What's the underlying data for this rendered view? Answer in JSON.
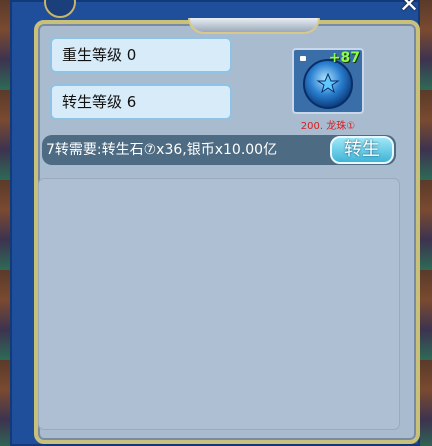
{
  "header": {
    "close_icon": "close-icon"
  },
  "status": {
    "reborn_level": "重生等级  0",
    "rebirth_level": "转生等级  6"
  },
  "item": {
    "icon": "dragon-ball-icon",
    "count": "+87",
    "caption": "200. 龙珠①"
  },
  "requirement": {
    "text": "7转需要:转生石⑦x36,银币x10.00亿",
    "button_label": "转生"
  },
  "colors": {
    "frame": "#1f4f9a",
    "panel": "#a9bbcf",
    "gold": "#c9c07a",
    "count_green": "#8dff4a",
    "caption_red": "#d42020",
    "button": "#3fb4d8"
  }
}
